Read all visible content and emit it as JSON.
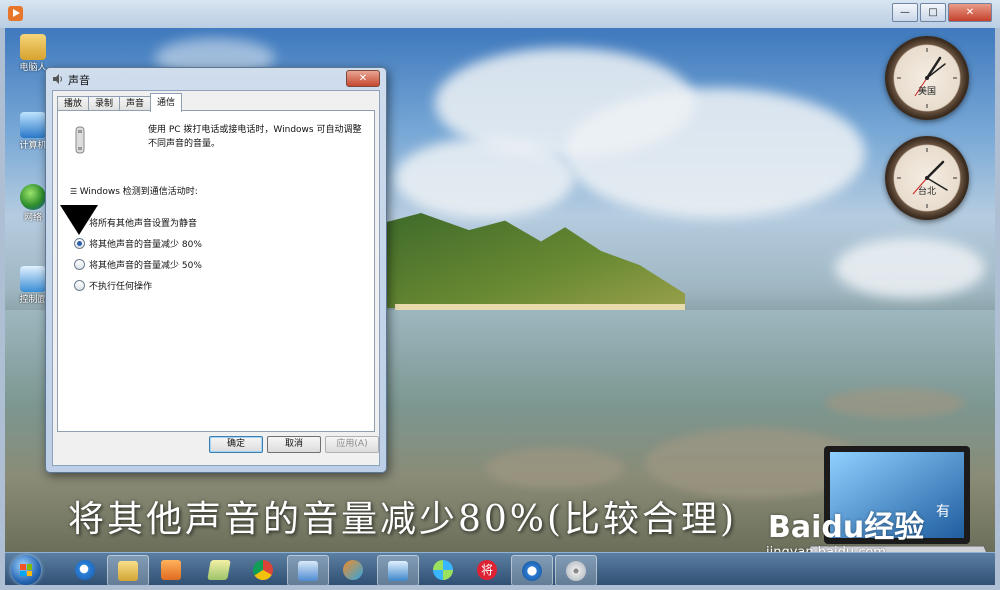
{
  "outer_window": {
    "controls": {
      "minimize": "—",
      "maximize": "□",
      "close": "✕"
    }
  },
  "desktop": {
    "icons": [
      {
        "name": "folder",
        "label": "电脑人"
      },
      {
        "name": "computer",
        "label": "计算机"
      },
      {
        "name": "network",
        "label": "网络"
      },
      {
        "name": "control-panel",
        "label": "控制面"
      }
    ],
    "clocks": [
      {
        "label": "美国"
      },
      {
        "label": "台北"
      }
    ]
  },
  "dialog": {
    "title": "声音",
    "tabs": [
      "播放",
      "录制",
      "声音",
      "通信"
    ],
    "active_tab": "通信",
    "description": "使用 PC 拨打电话或接电话时，Windows 可自动调整不同声音的音量。",
    "detect_label": "Windows 检测到通信活动时:",
    "options": [
      {
        "label": "将所有其他声音设置为静音",
        "checked": false
      },
      {
        "label": "将其他声音的音量减少 80%",
        "checked": true
      },
      {
        "label": "将其他声音的音量减少 50%",
        "checked": false
      },
      {
        "label": "不执行任何操作",
        "checked": false
      }
    ],
    "buttons": {
      "ok": "确定",
      "cancel": "取消",
      "apply": "应用(A)"
    }
  },
  "overlay": {
    "caption": "将其他声音的音量减少80%(比较合理)",
    "watermark_logo": "Baidu经验",
    "watermark_url": "jingyan.baidu.com",
    "laptop_screen_text": "有"
  },
  "taskbar": {
    "items": [
      "ie-browser",
      "file-explorer",
      "media-player",
      "folder",
      "chrome",
      "document",
      "paint",
      "remote-desktop",
      "pinwheel-app",
      "jiang-app",
      "browser-circle",
      "disc-app"
    ],
    "jiang_label": "将"
  },
  "colors": {
    "caption": "#ffffff",
    "accent": "#2d5ea8",
    "taskbar": "#2f4f72"
  }
}
